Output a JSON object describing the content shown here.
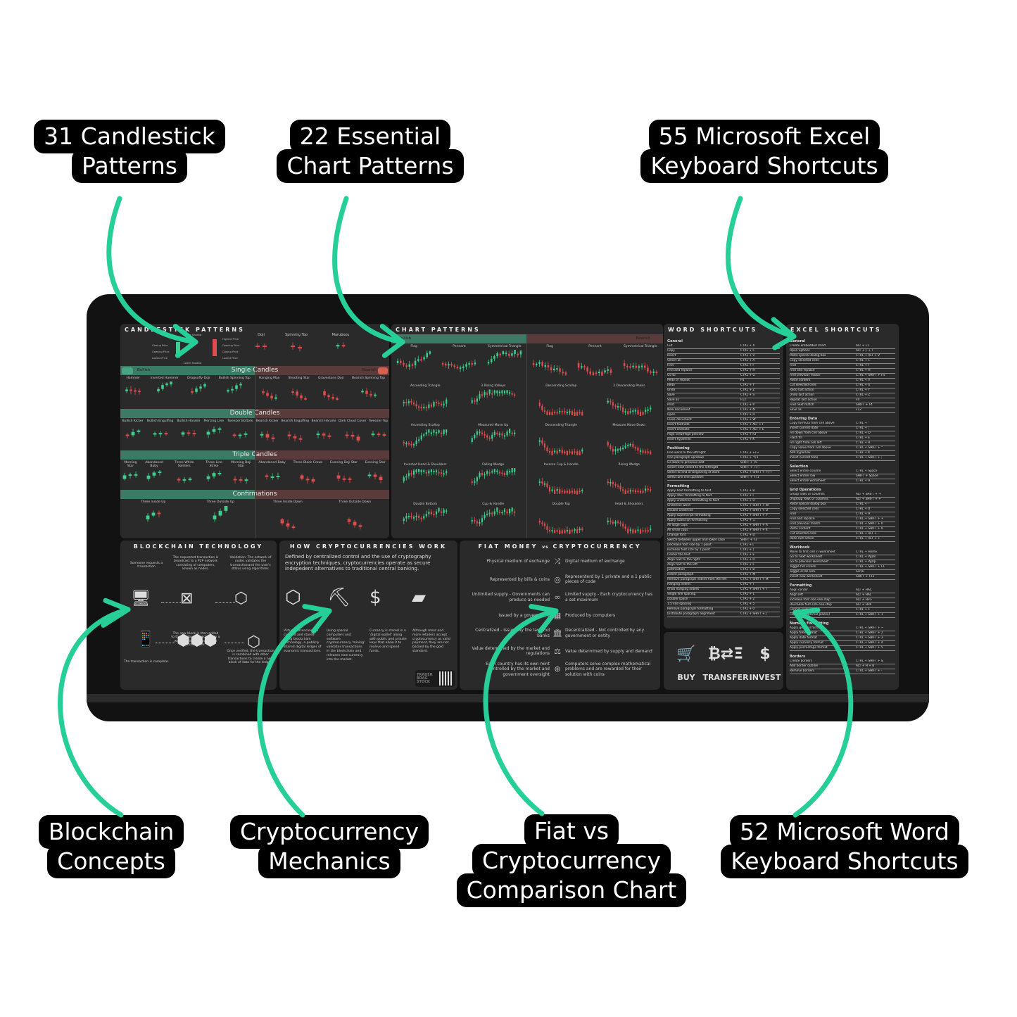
{
  "callouts": {
    "candlestick": [
      "31  Candlestick",
      "Patterns"
    ],
    "chart": [
      "22 Essential",
      "Chart Patterns"
    ],
    "excel": [
      "55 Microsoft Excel",
      "Keyboard Shortcuts"
    ],
    "blockchain": [
      "Blockchain",
      "Concepts"
    ],
    "crypto": [
      "Cryptocurrency",
      "Mechanics"
    ],
    "fiat": [
      "Fiat vs",
      "Cryptocurrency",
      "Comparison Chart"
    ],
    "word": [
      "52 Microsoft Word",
      "Keyboard Shortcuts"
    ]
  },
  "colors": {
    "arrow": "#26cf98",
    "bull": "#3c7a66",
    "bear": "#5a3b3b",
    "candle_up": "#3ecf8e",
    "candle_down": "#e04b4b",
    "mat": "#121212",
    "panel": "#2a2a2a"
  },
  "candlestick": {
    "title": "CANDLESTICK PATTERNS",
    "anatomy": {
      "left": [
        "Upper Shadow",
        "Closing Price",
        "Opening Price",
        "Lowest Price"
      ],
      "mid": [
        "Body",
        "Lower Shadow"
      ],
      "right": [
        "Highest Price",
        "Opening Price",
        "Closing Price",
        "Lowest Price"
      ]
    },
    "basics": [
      "Doji",
      "Spinning Top",
      "Marubozu"
    ],
    "bullish": "Bullish",
    "bearish": "Bearish",
    "sections": [
      {
        "title": "Single Candles",
        "bull": [
          "Hammer",
          "Inverted Hammer",
          "Dragonfly Doji",
          "Bullish Spinning Top"
        ],
        "bear": [
          "Hanging Man",
          "Shooting Star",
          "Gravestone Doji",
          "Bearish Spinning Top"
        ]
      },
      {
        "title": "Double Candles",
        "bull": [
          "Bullish Kicker",
          "Bullish Engulfing",
          "Bullish Harami",
          "Piercing Line",
          "Tweezer Bottom"
        ],
        "bear": [
          "Bearish Kicker",
          "Bearish Engulfing",
          "Bearish Harami",
          "Dark Cloud Cover",
          "Tweezer Top"
        ]
      },
      {
        "title": "Triple Candles",
        "bull": [
          "Morning Star",
          "Abandoned Baby",
          "Three White Soldiers",
          "Three Line Strike",
          "Morning Doji Star"
        ],
        "bear": [
          "Abandoned Baby",
          "Three Black Crows",
          "Evening Doji Star",
          "Evening Star"
        ]
      },
      {
        "title": "Confirmations",
        "bull": [
          "Three Inside Up",
          "Three Outside Up"
        ],
        "bear": [
          "Three Inside Down",
          "Three Outside Down"
        ]
      }
    ]
  },
  "chart_patterns": {
    "title": "CHART PATTERNS",
    "bullish": "Bullish",
    "bearish": "Bearish",
    "bull": [
      [
        "Flag",
        "Pennant",
        "Symmetrical Triangle"
      ],
      [
        "Ascending Triangle",
        "3 Rising Valleys"
      ],
      [
        "Ascending Scallop",
        "Measured Move Up"
      ],
      [
        "Inverted Head & Shoulders",
        "Falling Wedge"
      ],
      [
        "Double Bottom",
        "Cup & Handle"
      ]
    ],
    "bear": [
      [
        "Flag",
        "Pennant",
        "Symmetrical Triangle"
      ],
      [
        "Descending Scallop",
        "3 Descending Peaks"
      ],
      [
        "Descending Triangle",
        "Measure Move Down"
      ],
      [
        "Inverse Cup & Handle",
        "Rising Wedge"
      ],
      [
        "Double Top",
        "Head & Shoulders"
      ]
    ]
  },
  "word": {
    "title": "WORD SHORTCUTS",
    "groups": [
      {
        "name": "General",
        "items": [
          [
            "Cut",
            "CTRL + X"
          ],
          [
            "Copy",
            "CTRL + C"
          ],
          [
            "Insert",
            "CTRL + V"
          ],
          [
            "Select all",
            "CTRL + A"
          ],
          [
            "Find",
            "CTRL + F"
          ],
          [
            "Find and replace",
            "CTRL + H"
          ],
          [
            "Go to",
            "CTRL + G"
          ],
          [
            "Redo or repeat",
            "F4"
          ],
          [
            "Redo",
            "CTRL + Y"
          ],
          [
            "Undo",
            "CTRL + Z"
          ],
          [
            "Save",
            "CTRL + S"
          ],
          [
            "Save as",
            "F12"
          ],
          [
            "Print",
            "CTRL + P"
          ],
          [
            "New document",
            "CTRL + N"
          ],
          [
            "Open",
            "CTRL + O"
          ],
          [
            "Close document",
            "CTRL + W"
          ],
          [
            "Insert footnote",
            "CTRL + ALT + F"
          ],
          [
            "Insert endnote",
            "CTRL + ALT + E"
          ],
          [
            "Page view/Page preview",
            "CTRL + F2"
          ],
          [
            "Insert hyperlink",
            "CTRL + K"
          ]
        ]
      },
      {
        "name": "Positioning",
        "items": [
          [
            "One word to the left/right",
            "CTRL + ←/→"
          ],
          [
            "One paragraph up/down",
            "CTRL + ↑/↓"
          ],
          [
            "Go back to previous edit",
            "SHIFT + F5"
          ],
          [
            "Select next select to the left/right",
            "SHIFT + ←/→"
          ],
          [
            "Select to end or beginning of word",
            "CTRL + SHIFT + ←/→"
          ],
          [
            "Select one line up/down",
            "SHIFT + ↑/↓"
          ]
        ]
      },
      {
        "name": "Formatting",
        "items": [
          [
            "Apply bold formatting to text",
            "CTRL + B"
          ],
          [
            "Apply italic formatting to text",
            "CTRL + I"
          ],
          [
            "Apply underline formatting to text",
            "CTRL + U"
          ],
          [
            "Underline word",
            "CTRL + SHIFT + W"
          ],
          [
            "Double underline",
            "CTRL + SHIFT + D"
          ],
          [
            "Apply superscript formatting",
            "CTRL + SHIFT + +"
          ],
          [
            "Apply subscript formatting",
            "CTRL + ="
          ],
          [
            "All large caps",
            "CTRL + SHIFT + A"
          ],
          [
            "All small caps",
            "CTRL + SHIFT + K"
          ],
          [
            "Change font",
            "CTRL + D"
          ],
          [
            "Switch between upper and lower case",
            "SHIFT + F3"
          ],
          [
            "Decrease font size by 1 point",
            "CTRL + ["
          ],
          [
            "Increase font size by 1 point",
            "CTRL + ]"
          ],
          [
            "Center the text",
            "CTRL + E"
          ],
          [
            "Align text to the right",
            "CTRL + R"
          ],
          [
            "Align text to the left",
            "CTRL + L"
          ],
          [
            "Justification",
            "CTRL + B"
          ],
          [
            "Indent paragraph",
            "CTRL + M"
          ],
          [
            "Remove paragraph indent from the left",
            "CTRL + SHIFT + M"
          ],
          [
            "Hanging indent",
            "CTRL + T"
          ],
          [
            "Undo hanging indent",
            "CTRL + SHIFT + T"
          ],
          [
            "Single line spacing",
            "CTRL + 1"
          ],
          [
            "Double space",
            "CTRL + 2"
          ],
          [
            "1.5 line spacing",
            "CTRL + 5"
          ],
          [
            "Remove paragraph formatting",
            "CTRL + 0"
          ],
          [
            "Distribute paragraph alignment",
            "CTRL + SHIFT + J"
          ]
        ]
      }
    ]
  },
  "excel": {
    "title": "EXCEL SHORTCUTS",
    "groups": [
      {
        "name": "General",
        "items": [
          [
            "Create embedded chart",
            "ALT + F1"
          ],
          [
            "Open options",
            "ALT + F + T"
          ],
          [
            "Paste special dialog box",
            "CTRL + ALT + V"
          ],
          [
            "Copy selected cells",
            "CTRL + C"
          ],
          [
            "Find",
            "CTRL + F"
          ],
          [
            "Find and replace",
            "CTRL + H"
          ],
          [
            "Find previous match",
            "CTRL + SHIFT + F4"
          ],
          [
            "Paste content",
            "CTRL + V"
          ],
          [
            "Cut selected cells",
            "CTRL + X"
          ],
          [
            "Redo last action",
            "CTRL + Y"
          ],
          [
            "Undo last action",
            "CTRL + Z"
          ],
          [
            "Repeat last action",
            "F4"
          ],
          [
            "Find next match",
            "SHIFT + F4"
          ],
          [
            "Save as",
            "F12"
          ]
        ]
      },
      {
        "name": "Entering Data",
        "items": [
          [
            "Copy formula from cell above",
            "CTRL + '"
          ],
          [
            "Insert current date",
            "CTRL + ;"
          ],
          [
            "Fill down from cell above",
            "CTRL + D"
          ],
          [
            "Flash fill",
            "CTRL + E"
          ],
          [
            "Fill right from cell left",
            "CTRL + R"
          ],
          [
            "Copy value from cell above",
            "CTRL + SHIFT + \""
          ],
          [
            "Add hyperlink",
            "CTRL + K"
          ],
          [
            "Insert current time",
            "CTRL + SHIFT + ;"
          ]
        ]
      },
      {
        "name": "Selection",
        "items": [
          [
            "Select entire column",
            "CTRL + Space"
          ],
          [
            "Select entire row",
            "SHIFT + Space"
          ],
          [
            "Select entire worksheet",
            "CTRL + A"
          ]
        ]
      },
      {
        "name": "Grid Operations",
        "items": [
          [
            "Group rows or columns",
            "ALT + SHIFT + →"
          ],
          [
            "Ungroup rows or columns",
            "ALT + SHIFT + ←"
          ],
          [
            "Paste special dialog box",
            "CTRL + -"
          ],
          [
            "Copy selected cells",
            "CTRL + 0"
          ],
          [
            "Find",
            "CTRL + 9"
          ],
          [
            "Find and replace",
            "CTRL + SHIFT + +"
          ],
          [
            "Find previous match",
            "CTRL + SHIFT + 0"
          ],
          [
            "Paste content",
            "CTRL + SHIFT + 9"
          ],
          [
            "Cut selected cells",
            "CTRL + ALT + -"
          ],
          [
            "Redo last action",
            "CTRL + ALT + +"
          ]
        ]
      },
      {
        "name": "Workbook",
        "items": [
          [
            "Move to first cell in worksheet",
            "CTRL + Home"
          ],
          [
            "Go to next worksheet",
            "CTRL + PgDn"
          ],
          [
            "Go to previous worksheet",
            "CTRL + PgUp"
          ],
          [
            "Toggle full screen",
            "CTRL + SHIFT + F1"
          ],
          [
            "Toggle scroll lock",
            "ScrLk"
          ],
          [
            "Insert new worksheet",
            "SHIFT + F11"
          ]
        ]
      },
      {
        "name": "Formatting",
        "items": [
          [
            "Align center",
            "ALT + HAC"
          ],
          [
            "Align left",
            "ALT + HAL"
          ],
          [
            "Increase font size one step",
            "ALT + HFG"
          ],
          [
            "Decrease font size one step",
            "ALT + HFK"
          ],
          [
            "Format cells",
            "CTRL + 1"
          ],
          [
            "Format (# decimal places)",
            "CTRL + SHIFT + 1"
          ]
        ]
      },
      {
        "name": "Number Formatting",
        "items": [
          [
            "Apply general format",
            "CTRL + SHIFT + ~"
          ],
          [
            "Apply time format",
            "CTRL + SHIFT + 2"
          ],
          [
            "Apply date format",
            "CTRL + SHIFT + 3"
          ],
          [
            "Apply currency format",
            "CTRL + SHIFT + 4"
          ],
          [
            "Apply percentage format",
            "CTRL + SHIFT + 5"
          ]
        ]
      },
      {
        "name": "Borders",
        "items": [
          [
            "Create borders",
            "CTRL + SHIFT + &"
          ],
          [
            "Add border outline",
            "ALT + H + B"
          ],
          [
            "Remove borders",
            "CTRL + SHIFT + -"
          ]
        ]
      }
    ]
  },
  "blockchain": {
    "title": "BLOCKCHAIN TECHNOLOGY",
    "steps": [
      "Someone requests a transaction",
      "The requested transaction is broadcast to a P2P network consisting of computers, known as nodes.",
      "Validation: The network of nodes validates the transactionand the user's status using algorithms.",
      "Once verified, the transaction is combined with other transactions to create a new block of data for the ledger.",
      "The new block is then added to the existing blockchain, in a way that is permanent and unalterable.",
      "The transaction is complete."
    ]
  },
  "crypto": {
    "title": "HOW CRYPTOCURRENCIES WORK",
    "intro": "Defined by centralized control and the use of cryptography encryption techniques, cryptocurrencies operate as secure indepedent alternatives to traditional central banking.",
    "captions": [
      "Virtual currencies are created and stored using blockchain technology, a publicly shared digital ledger of economic transactions.",
      "Using special computers and software, cryptocurrency 'mining' validates transactions in the blockchain and releases new currency into the market.",
      "Currency is stored in a 'digital wallet' along with public and private keys that allow it to receive and spend funds.",
      "Although more and more retailers accept cryptocurrency as valid payment, they are not backed by the gold standard."
    ],
    "logo": "TRADER BRAG STOCK"
  },
  "fiat": {
    "title_a": "FIAT MONEY",
    "vs": "vs",
    "title_b": "CRYPTOCURRENCY",
    "rows": [
      {
        "fiat": "Physical medium of exchange",
        "icon": "shuffle-icon",
        "glyph": "⤨",
        "crypto": "Digital medium of exchange"
      },
      {
        "fiat": "Represented by bills & coins",
        "icon": "coins-icon",
        "glyph": "◎",
        "crypto": "Representerd by 1 private and a 1 public pieces of code"
      },
      {
        "fiat": "Untimited supply - Governments can produce as needed",
        "icon": "infinity-icon",
        "glyph": "∞",
        "crypto": "Limited supply - Each cryptocurrency has a set maximum"
      },
      {
        "fiat": "Issued by a government",
        "icon": "server-icon",
        "glyph": "▦",
        "crypto": "Produced by computers"
      },
      {
        "fiat": "Centralized - Issued by the law and banks",
        "icon": "bank-icon",
        "glyph": "🏛",
        "crypto": "Decentralized - Not controlled by any government or entity"
      },
      {
        "fiat": "Value determined by the market and regulations",
        "icon": "scales-icon",
        "glyph": "⚖",
        "crypto": "Value determined by supply and demand"
      },
      {
        "fiat": "Each country has its own mint controlled by the market and government oversight",
        "icon": "globe-icon",
        "glyph": "⊕",
        "crypto": "Computers solve complex mathematical problems and are rewarded for their solution with coins"
      }
    ]
  },
  "actions": [
    {
      "label": "BUY",
      "icon": "cart-icon",
      "glyph": "🛒"
    },
    {
      "label": "TRANSFER",
      "icon": "bitcoin-ethereum-exchange-icon",
      "glyph": "₿⇄Ξ"
    },
    {
      "label": "INVEST",
      "icon": "hand-plant-coin-icon",
      "glyph": "$"
    }
  ]
}
